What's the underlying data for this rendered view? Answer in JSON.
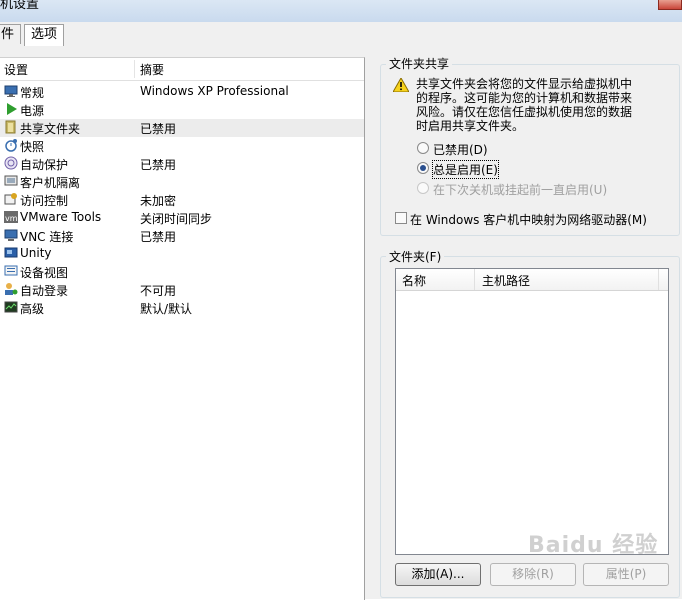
{
  "window": {
    "title": "机设置"
  },
  "tabs": [
    {
      "label": "件"
    },
    {
      "label": "选项"
    }
  ],
  "list": {
    "header": {
      "setting": "设置",
      "summary": "摘要"
    },
    "items": [
      {
        "name": "常规",
        "summary": "Windows XP Professional",
        "icon": "monitor-icon"
      },
      {
        "name": "电源",
        "summary": "",
        "icon": "play-icon"
      },
      {
        "name": "共享文件夹",
        "summary": "已禁用",
        "icon": "shared-folder-icon"
      },
      {
        "name": "快照",
        "summary": "",
        "icon": "snapshot-icon"
      },
      {
        "name": "自动保护",
        "summary": "已禁用",
        "icon": "autoprotect-icon"
      },
      {
        "name": "客户机隔离",
        "summary": "",
        "icon": "isolation-icon"
      },
      {
        "name": "访问控制",
        "summary": "未加密",
        "icon": "access-control-icon"
      },
      {
        "name": "VMware Tools",
        "summary": "关闭时间同步",
        "icon": "vmware-tools-icon"
      },
      {
        "name": "VNC 连接",
        "summary": "已禁用",
        "icon": "vnc-icon"
      },
      {
        "name": "Unity",
        "summary": "",
        "icon": "unity-icon"
      },
      {
        "name": "设备视图",
        "summary": "",
        "icon": "device-view-icon"
      },
      {
        "name": "自动登录",
        "summary": "不可用",
        "icon": "autologin-icon"
      },
      {
        "name": "高级",
        "summary": "默认/默认",
        "icon": "advanced-icon"
      }
    ],
    "selected": "共享文件夹"
  },
  "sharing": {
    "legend": "文件夹共享",
    "warning_lines": [
      "共享文件夹会将您的文件显示给虚拟机中",
      "的程序。这可能为您的计算机和数据带来",
      "风险。请仅在您信任虚拟机使用您的数据",
      "时启用共享文件夹。"
    ],
    "options": [
      {
        "label": "已禁用(D)",
        "checked": false,
        "disabled": false
      },
      {
        "label": "总是启用(E)",
        "checked": true,
        "disabled": false
      },
      {
        "label": "在下次关机或挂起前一直启用(U)",
        "checked": false,
        "disabled": true
      }
    ],
    "map_drive_label": "在 Windows 客户机中映射为网络驱动器(M)"
  },
  "folders": {
    "legend": "文件夹(F)",
    "columns": [
      "名称",
      "主机路径"
    ],
    "buttons": {
      "add": "添加(A)...",
      "remove": "移除(R)",
      "properties": "属性(P)"
    }
  },
  "watermark": "Baidu 经验",
  "colors": {
    "titlebar": "#c9daee",
    "selected_row": "#ececec",
    "radio_dot": "#2a4f8f"
  }
}
